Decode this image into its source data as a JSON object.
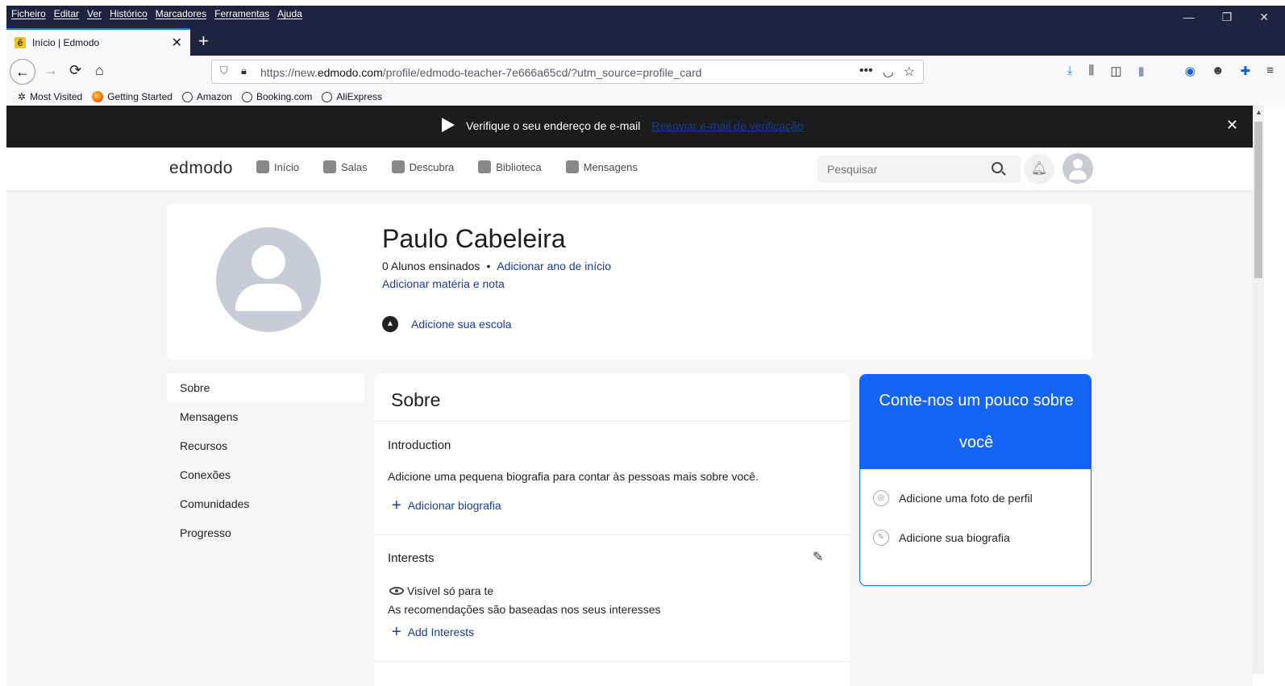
{
  "menubar": {
    "items": [
      "Ficheiro",
      "Editar",
      "Ver",
      "Histórico",
      "Marcadores",
      "Ferramentas",
      "Ajuda"
    ],
    "minimize": "—",
    "restore": "❐",
    "close": "✕"
  },
  "tab": {
    "title": "Início | Edmodo",
    "favicon": "ē",
    "close": "✕",
    "new": "+"
  },
  "nav": {
    "back": "←",
    "forward": "→",
    "reload": "⟳",
    "home": "⌂"
  },
  "url": {
    "prefix": "https://new.",
    "domain": "edmodo.com",
    "path": "/profile/edmodo-teacher-7e666a65cd/?utm_source=profile_card",
    "more": "•••",
    "pocket": "◡",
    "star": "☆"
  },
  "toolbar": {
    "download": "⤓",
    "library": "⫼",
    "sidebar": "◫",
    "ext1": "▮",
    "ext2": "◉",
    "account": "☻",
    "ext3": "✚",
    "menu": "≡"
  },
  "bookmarks": [
    "Most Visited",
    "Getting Started",
    "Amazon",
    "Booking.com",
    "AliExpress"
  ],
  "banner": {
    "message": "Verifique o seu endereço de e-mail",
    "link": "Reenviar e-mail de verificação",
    "close": "✕"
  },
  "site": {
    "logo": "edmodo",
    "nav": [
      "Início",
      "Salas",
      "Descubra",
      "Biblioteca",
      "Mensagens"
    ],
    "search_placeholder": "Pesquisar"
  },
  "profile": {
    "name": "Paulo Cabeleira",
    "students": "0 Alunos ensinados",
    "bullet": "•",
    "add_year": "Adicionar ano de início",
    "add_subject": "Adicionar matéria e nota",
    "add_school": "Adicione sua escola"
  },
  "sidemenu": [
    "Sobre",
    "Mensagens",
    "Recursos",
    "Conexões",
    "Comunidades",
    "Progresso"
  ],
  "about": {
    "title": "Sobre",
    "intro_title": "Introduction",
    "intro_text": "Adicione uma pequena biografia para contar às pessoas mais sobre você.",
    "add_bio": "Adicionar biografia",
    "interests_title": "Interests",
    "visibility": "Visível só para te",
    "recommendation": "As recomendações são baseadas nos seus interesses",
    "add_interests": "Add Interests"
  },
  "promo": {
    "title_line1": "Conte-nos um pouco sobre",
    "title_line2": "você",
    "item1": "Adicione uma foto de perfil",
    "item2": "Adicione sua biografia"
  }
}
